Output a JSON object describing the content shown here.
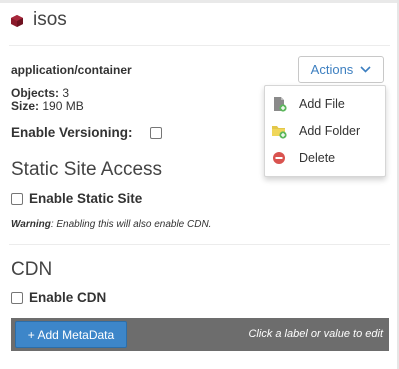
{
  "container": {
    "name": "isos",
    "icon": "container-cube-icon",
    "icon_color": "#8b1a2b",
    "content_type": "application/container",
    "objects_label": "Objects:",
    "objects_value": "3",
    "size_label": "Size:",
    "size_value": "190 MB"
  },
  "versioning": {
    "label": "Enable Versioning:",
    "checked": false
  },
  "static_site": {
    "heading": "Static Site Access",
    "checkbox_label": "Enable Static Site",
    "checked": false,
    "warning_label": "Warning",
    "warning_text": ": Enabling this will also enable CDN."
  },
  "cdn": {
    "heading": "CDN",
    "checkbox_label": "Enable CDN",
    "checked": false
  },
  "metadata": {
    "add_button_label": "+ Add MetaData",
    "hint": "Click a label or value to edit"
  },
  "actions": {
    "button_label": "Actions",
    "accent_color": "#3d7fc0",
    "menu": [
      {
        "label": "Add File",
        "icon": "add-file-icon"
      },
      {
        "label": "Add Folder",
        "icon": "add-folder-icon"
      },
      {
        "label": "Delete",
        "icon": "delete-icon"
      }
    ]
  }
}
